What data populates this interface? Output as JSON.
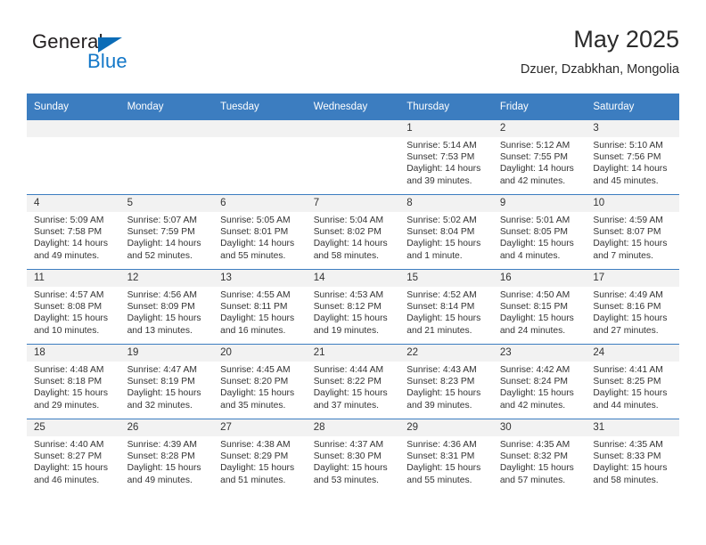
{
  "brand": {
    "word_one": "General",
    "word_two": "Blue",
    "triangle_color": "#0b6cb7",
    "blue_text_color": "#1277c8"
  },
  "header": {
    "title": "May 2025",
    "subtitle": "Dzuer, Dzabkhan, Mongolia"
  },
  "calendar": {
    "accent_color": "#3c7dc0",
    "daystrip_color": "#f2f2f2",
    "weekdays": [
      "Sunday",
      "Monday",
      "Tuesday",
      "Wednesday",
      "Thursday",
      "Friday",
      "Saturday"
    ],
    "weeks": [
      [
        {
          "day": "",
          "sunrise": "",
          "sunset": "",
          "daylight": "",
          "empty": true
        },
        {
          "day": "",
          "sunrise": "",
          "sunset": "",
          "daylight": "",
          "empty": true
        },
        {
          "day": "",
          "sunrise": "",
          "sunset": "",
          "daylight": "",
          "empty": true
        },
        {
          "day": "",
          "sunrise": "",
          "sunset": "",
          "daylight": "",
          "empty": true
        },
        {
          "day": "1",
          "sunrise": "Sunrise: 5:14 AM",
          "sunset": "Sunset: 7:53 PM",
          "daylight": "Daylight: 14 hours and 39 minutes."
        },
        {
          "day": "2",
          "sunrise": "Sunrise: 5:12 AM",
          "sunset": "Sunset: 7:55 PM",
          "daylight": "Daylight: 14 hours and 42 minutes."
        },
        {
          "day": "3",
          "sunrise": "Sunrise: 5:10 AM",
          "sunset": "Sunset: 7:56 PM",
          "daylight": "Daylight: 14 hours and 45 minutes."
        }
      ],
      [
        {
          "day": "4",
          "sunrise": "Sunrise: 5:09 AM",
          "sunset": "Sunset: 7:58 PM",
          "daylight": "Daylight: 14 hours and 49 minutes."
        },
        {
          "day": "5",
          "sunrise": "Sunrise: 5:07 AM",
          "sunset": "Sunset: 7:59 PM",
          "daylight": "Daylight: 14 hours and 52 minutes."
        },
        {
          "day": "6",
          "sunrise": "Sunrise: 5:05 AM",
          "sunset": "Sunset: 8:01 PM",
          "daylight": "Daylight: 14 hours and 55 minutes."
        },
        {
          "day": "7",
          "sunrise": "Sunrise: 5:04 AM",
          "sunset": "Sunset: 8:02 PM",
          "daylight": "Daylight: 14 hours and 58 minutes."
        },
        {
          "day": "8",
          "sunrise": "Sunrise: 5:02 AM",
          "sunset": "Sunset: 8:04 PM",
          "daylight": "Daylight: 15 hours and 1 minute."
        },
        {
          "day": "9",
          "sunrise": "Sunrise: 5:01 AM",
          "sunset": "Sunset: 8:05 PM",
          "daylight": "Daylight: 15 hours and 4 minutes."
        },
        {
          "day": "10",
          "sunrise": "Sunrise: 4:59 AM",
          "sunset": "Sunset: 8:07 PM",
          "daylight": "Daylight: 15 hours and 7 minutes."
        }
      ],
      [
        {
          "day": "11",
          "sunrise": "Sunrise: 4:57 AM",
          "sunset": "Sunset: 8:08 PM",
          "daylight": "Daylight: 15 hours and 10 minutes."
        },
        {
          "day": "12",
          "sunrise": "Sunrise: 4:56 AM",
          "sunset": "Sunset: 8:09 PM",
          "daylight": "Daylight: 15 hours and 13 minutes."
        },
        {
          "day": "13",
          "sunrise": "Sunrise: 4:55 AM",
          "sunset": "Sunset: 8:11 PM",
          "daylight": "Daylight: 15 hours and 16 minutes."
        },
        {
          "day": "14",
          "sunrise": "Sunrise: 4:53 AM",
          "sunset": "Sunset: 8:12 PM",
          "daylight": "Daylight: 15 hours and 19 minutes."
        },
        {
          "day": "15",
          "sunrise": "Sunrise: 4:52 AM",
          "sunset": "Sunset: 8:14 PM",
          "daylight": "Daylight: 15 hours and 21 minutes."
        },
        {
          "day": "16",
          "sunrise": "Sunrise: 4:50 AM",
          "sunset": "Sunset: 8:15 PM",
          "daylight": "Daylight: 15 hours and 24 minutes."
        },
        {
          "day": "17",
          "sunrise": "Sunrise: 4:49 AM",
          "sunset": "Sunset: 8:16 PM",
          "daylight": "Daylight: 15 hours and 27 minutes."
        }
      ],
      [
        {
          "day": "18",
          "sunrise": "Sunrise: 4:48 AM",
          "sunset": "Sunset: 8:18 PM",
          "daylight": "Daylight: 15 hours and 29 minutes."
        },
        {
          "day": "19",
          "sunrise": "Sunrise: 4:47 AM",
          "sunset": "Sunset: 8:19 PM",
          "daylight": "Daylight: 15 hours and 32 minutes."
        },
        {
          "day": "20",
          "sunrise": "Sunrise: 4:45 AM",
          "sunset": "Sunset: 8:20 PM",
          "daylight": "Daylight: 15 hours and 35 minutes."
        },
        {
          "day": "21",
          "sunrise": "Sunrise: 4:44 AM",
          "sunset": "Sunset: 8:22 PM",
          "daylight": "Daylight: 15 hours and 37 minutes."
        },
        {
          "day": "22",
          "sunrise": "Sunrise: 4:43 AM",
          "sunset": "Sunset: 8:23 PM",
          "daylight": "Daylight: 15 hours and 39 minutes."
        },
        {
          "day": "23",
          "sunrise": "Sunrise: 4:42 AM",
          "sunset": "Sunset: 8:24 PM",
          "daylight": "Daylight: 15 hours and 42 minutes."
        },
        {
          "day": "24",
          "sunrise": "Sunrise: 4:41 AM",
          "sunset": "Sunset: 8:25 PM",
          "daylight": "Daylight: 15 hours and 44 minutes."
        }
      ],
      [
        {
          "day": "25",
          "sunrise": "Sunrise: 4:40 AM",
          "sunset": "Sunset: 8:27 PM",
          "daylight": "Daylight: 15 hours and 46 minutes."
        },
        {
          "day": "26",
          "sunrise": "Sunrise: 4:39 AM",
          "sunset": "Sunset: 8:28 PM",
          "daylight": "Daylight: 15 hours and 49 minutes."
        },
        {
          "day": "27",
          "sunrise": "Sunrise: 4:38 AM",
          "sunset": "Sunset: 8:29 PM",
          "daylight": "Daylight: 15 hours and 51 minutes."
        },
        {
          "day": "28",
          "sunrise": "Sunrise: 4:37 AM",
          "sunset": "Sunset: 8:30 PM",
          "daylight": "Daylight: 15 hours and 53 minutes."
        },
        {
          "day": "29",
          "sunrise": "Sunrise: 4:36 AM",
          "sunset": "Sunset: 8:31 PM",
          "daylight": "Daylight: 15 hours and 55 minutes."
        },
        {
          "day": "30",
          "sunrise": "Sunrise: 4:35 AM",
          "sunset": "Sunset: 8:32 PM",
          "daylight": "Daylight: 15 hours and 57 minutes."
        },
        {
          "day": "31",
          "sunrise": "Sunrise: 4:35 AM",
          "sunset": "Sunset: 8:33 PM",
          "daylight": "Daylight: 15 hours and 58 minutes."
        }
      ]
    ]
  }
}
